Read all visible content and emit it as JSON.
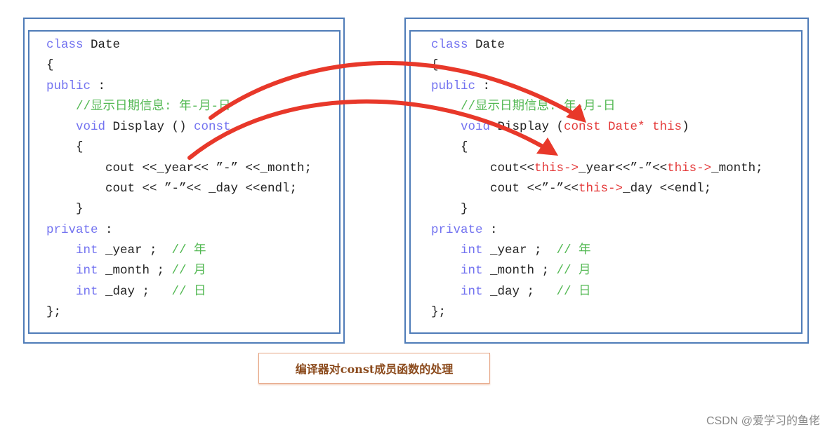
{
  "colors": {
    "keyword": "#7272f0",
    "comment": "#52b852",
    "highlight": "#e43a3a",
    "arrow": "#e8382a",
    "border": "#4f7cb8",
    "caption_text": "#8b4a1c"
  },
  "left_panel": {
    "lines": [
      [
        [
          "class ",
          "kw"
        ],
        [
          "Date",
          "tx"
        ]
      ],
      [
        [
          "{",
          "tx"
        ]
      ],
      [
        [
          "public ",
          "kw"
        ],
        [
          ":",
          "tx"
        ]
      ],
      [
        [
          "    //显示日期信息: 年-月-日",
          "cm"
        ]
      ],
      [
        [
          "    void ",
          "kw"
        ],
        [
          "Display () ",
          "tx"
        ],
        [
          "const",
          "kw"
        ]
      ],
      [
        [
          "    {",
          "tx"
        ]
      ],
      [
        [
          "        cout <<_year<< ”-” <<_month;",
          "tx"
        ]
      ],
      [
        [
          "        cout << ”-”<< _day <<endl;",
          "tx"
        ]
      ],
      [
        [
          "    }",
          "tx"
        ]
      ],
      [
        [
          "private ",
          "kw"
        ],
        [
          ":",
          "tx"
        ]
      ],
      [
        [
          "    int ",
          "kw"
        ],
        [
          "_year ;  ",
          "tx"
        ],
        [
          "// 年",
          "cm"
        ]
      ],
      [
        [
          "    int ",
          "kw"
        ],
        [
          "_month ; ",
          "tx"
        ],
        [
          "// 月",
          "cm"
        ]
      ],
      [
        [
          "    int ",
          "kw"
        ],
        [
          "_day ;   ",
          "tx"
        ],
        [
          "// 日",
          "cm"
        ]
      ],
      [
        [
          "};",
          "tx"
        ]
      ]
    ]
  },
  "right_panel": {
    "lines": [
      [
        [
          "class ",
          "kw"
        ],
        [
          "Date",
          "tx"
        ]
      ],
      [
        [
          "{",
          "tx"
        ]
      ],
      [
        [
          "public ",
          "kw"
        ],
        [
          ":",
          "tx"
        ]
      ],
      [
        [
          "    //显示日期信息: 年-月-日",
          "cm"
        ]
      ],
      [
        [
          "    void ",
          "kw"
        ],
        [
          "Display (",
          "tx"
        ],
        [
          "const Date* this",
          "rd"
        ],
        [
          ")",
          "tx"
        ]
      ],
      [
        [
          "    {",
          "tx"
        ]
      ],
      [
        [
          "        cout<<",
          "tx"
        ],
        [
          "this->",
          "rd"
        ],
        [
          "_year<<”-”<<",
          "tx"
        ],
        [
          "this->",
          "rd"
        ],
        [
          "_month;",
          "tx"
        ]
      ],
      [
        [
          "        cout <<”-”<<",
          "tx"
        ],
        [
          "this->",
          "rd"
        ],
        [
          "_day <<endl;",
          "tx"
        ]
      ],
      [
        [
          "    }",
          "tx"
        ]
      ],
      [
        [
          "private ",
          "kw"
        ],
        [
          ":",
          "tx"
        ]
      ],
      [
        [
          "    int ",
          "kw"
        ],
        [
          "_year ;  ",
          "tx"
        ],
        [
          "// 年",
          "cm"
        ]
      ],
      [
        [
          "    int ",
          "kw"
        ],
        [
          "_month ; ",
          "tx"
        ],
        [
          "// 月",
          "cm"
        ]
      ],
      [
        [
          "    int ",
          "kw"
        ],
        [
          "_day ;   ",
          "tx"
        ],
        [
          "// 日",
          "cm"
        ]
      ],
      [
        [
          "};",
          "tx"
        ]
      ]
    ]
  },
  "arrows": [
    {
      "from": "const qualifier",
      "to": "const Date* this parameter"
    },
    {
      "from": "_year access",
      "to": "this-> access"
    }
  ],
  "caption": "编译器对const成员函数的处理",
  "watermark": "CSDN @爱学习的鱼佬"
}
